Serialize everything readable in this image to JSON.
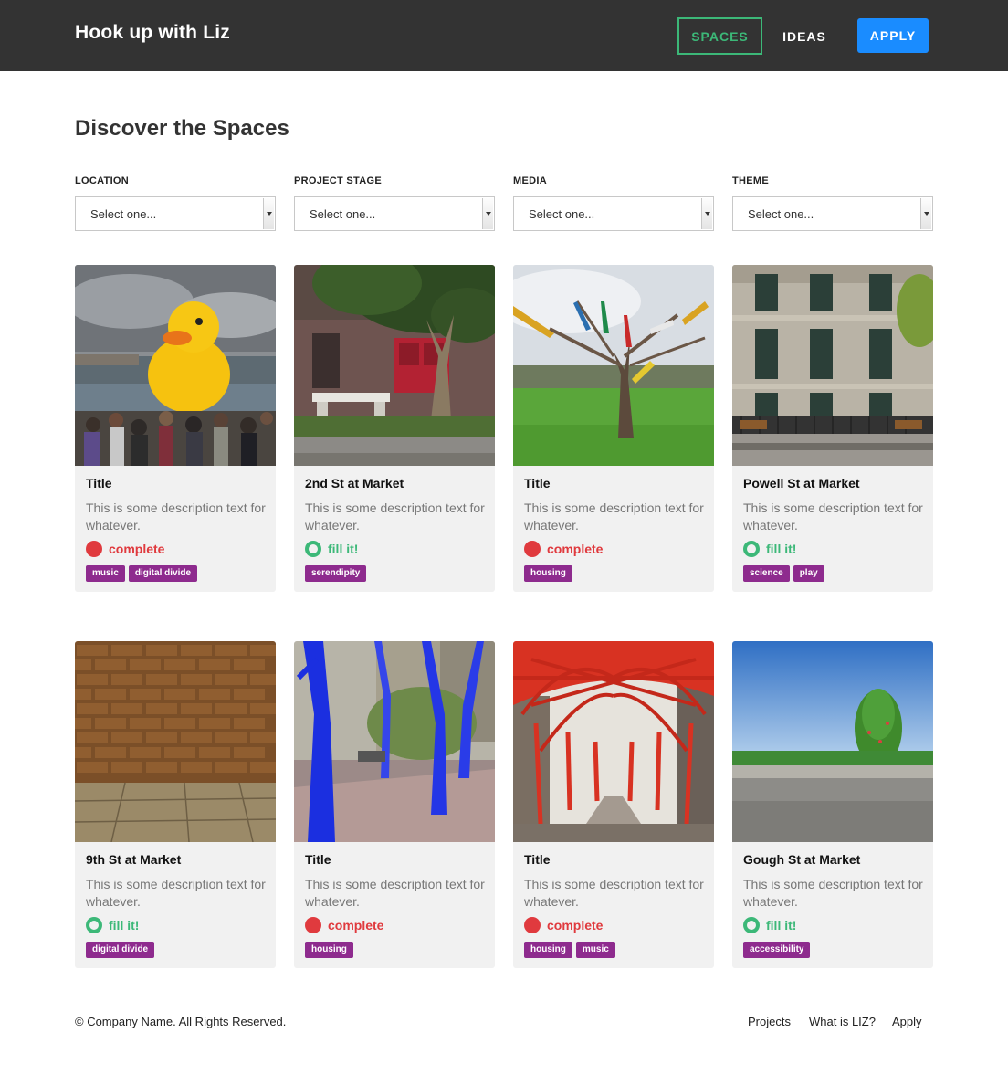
{
  "header": {
    "brand": "Hook up with Liz",
    "nav": {
      "spaces": "SPACES",
      "ideas": "IDEAS",
      "apply": "APPLY"
    }
  },
  "main": {
    "title": "Discover the Spaces",
    "filters": [
      {
        "label": "LOCATION",
        "value": "Select one..."
      },
      {
        "label": "PROJECT STAGE",
        "value": "Select one..."
      },
      {
        "label": "MEDIA",
        "value": "Select one..."
      },
      {
        "label": "THEME",
        "value": "Select one..."
      }
    ],
    "cards": [
      {
        "title": "Title",
        "description": "This is some description text for whatever.",
        "status": "complete",
        "tags": [
          "music",
          "digital divide"
        ],
        "image": "rubber-duck-photo"
      },
      {
        "title": "2nd St at Market",
        "description": "This is some description text for whatever.",
        "status": "fill it!",
        "tags": [
          "serendipity"
        ],
        "image": "tree-bench-photo"
      },
      {
        "title": "Title",
        "description": "This is some description text for whatever.",
        "status": "complete",
        "tags": [
          "housing"
        ],
        "image": "pencil-tree-photo"
      },
      {
        "title": "Powell St at Market",
        "description": "This is some description text for whatever.",
        "status": "fill it!",
        "tags": [
          "science",
          "play"
        ],
        "image": "building-benches-photo"
      },
      {
        "title": "9th St at Market",
        "description": "This is some description text for whatever.",
        "status": "fill it!",
        "tags": [
          "digital divide"
        ],
        "image": "brick-wall-photo"
      },
      {
        "title": "Title",
        "description": "This is some description text for whatever.",
        "status": "complete",
        "tags": [
          "housing"
        ],
        "image": "blue-trees-photo"
      },
      {
        "title": "Title",
        "description": "This is some description text for whatever.",
        "status": "complete",
        "tags": [
          "housing",
          "music"
        ],
        "image": "red-canopy-photo"
      },
      {
        "title": "Gough St at Market",
        "description": "This is some description text for whatever.",
        "status": "fill it!",
        "tags": [
          "accessibility"
        ],
        "image": "lone-tree-photo"
      }
    ]
  },
  "footer": {
    "copyright": "© Company Name. All Rights Reserved.",
    "links": [
      "Projects",
      "What is LIZ?",
      "Apply"
    ]
  },
  "colors": {
    "header_bg": "#333333",
    "accent_green": "#3cb878",
    "accent_blue": "#1a8cff",
    "complete_red": "#e03a3e",
    "tag_purple": "#8e2b8e",
    "card_bg": "#f1f1f1"
  }
}
